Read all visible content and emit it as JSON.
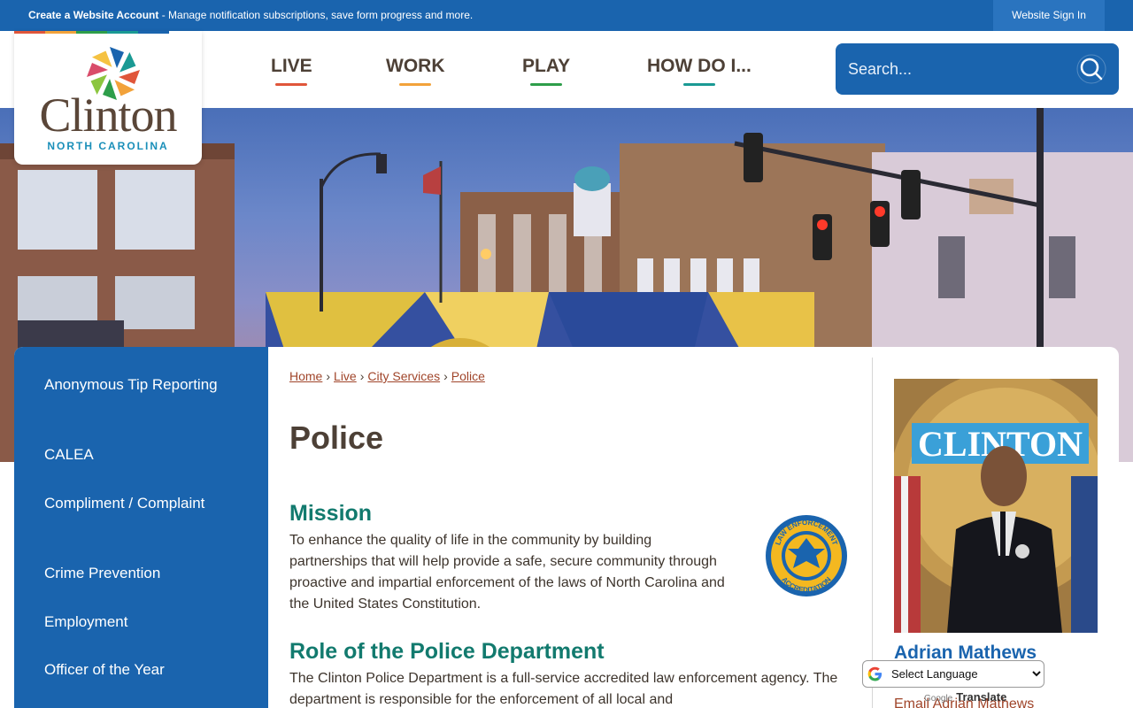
{
  "topbar": {
    "create_title": "Create a Website Account",
    "create_desc": " - Manage notification subscriptions, save form progress and more.",
    "signin_label": "Website Sign In"
  },
  "logo": {
    "name": "Clinton",
    "subtitle": "NORTH CAROLINA"
  },
  "nav": {
    "items": [
      {
        "label": "LIVE",
        "color": "#e0563a"
      },
      {
        "label": "WORK",
        "color": "#f2a23a"
      },
      {
        "label": "PLAY",
        "color": "#2e9e4a"
      },
      {
        "label": "HOW DO I...",
        "color": "#1a9a94"
      }
    ]
  },
  "search": {
    "placeholder": "Search..."
  },
  "sidebar": {
    "items": [
      {
        "label": "Anonymous Tip Reporting"
      },
      {
        "label": "CALEA"
      },
      {
        "label": "Compliment / Complaint"
      },
      {
        "label": "Crime Prevention"
      },
      {
        "label": "Employment"
      },
      {
        "label": "Officer of the Year"
      }
    ]
  },
  "breadcrumb": {
    "items": [
      "Home",
      "Live",
      "City Services",
      "Police"
    ],
    "separator": "›"
  },
  "page": {
    "title": "Police",
    "mission_heading": "Mission",
    "mission_text": "To enhance the quality of life in the community by building partnerships that will help provide a safe, secure community through proactive and impartial enforcement of the laws of North Carolina and the United States Constitution.",
    "role_heading": "Role of the Police Department",
    "role_text": "The Clinton Police Department is a full-service accredited law enforcement agency. The department is responsible for the enforcement of all local and"
  },
  "badge": {
    "top_text": "LAW ENFORCEMENT",
    "bottom_text": "ACCREDITATION"
  },
  "chief": {
    "photo_text": "CLINTON",
    "name": "Adrian Mathews",
    "email_label": "Email Adrian Mathews"
  },
  "translate": {
    "selected": "Select Language",
    "powered_google": "Google",
    "powered_word": "Translate"
  },
  "colors": {
    "brand_blue": "#1a64ae",
    "heading_teal": "#127a6e",
    "link_rust": "#a0452a",
    "text_brown": "#4d4036"
  }
}
